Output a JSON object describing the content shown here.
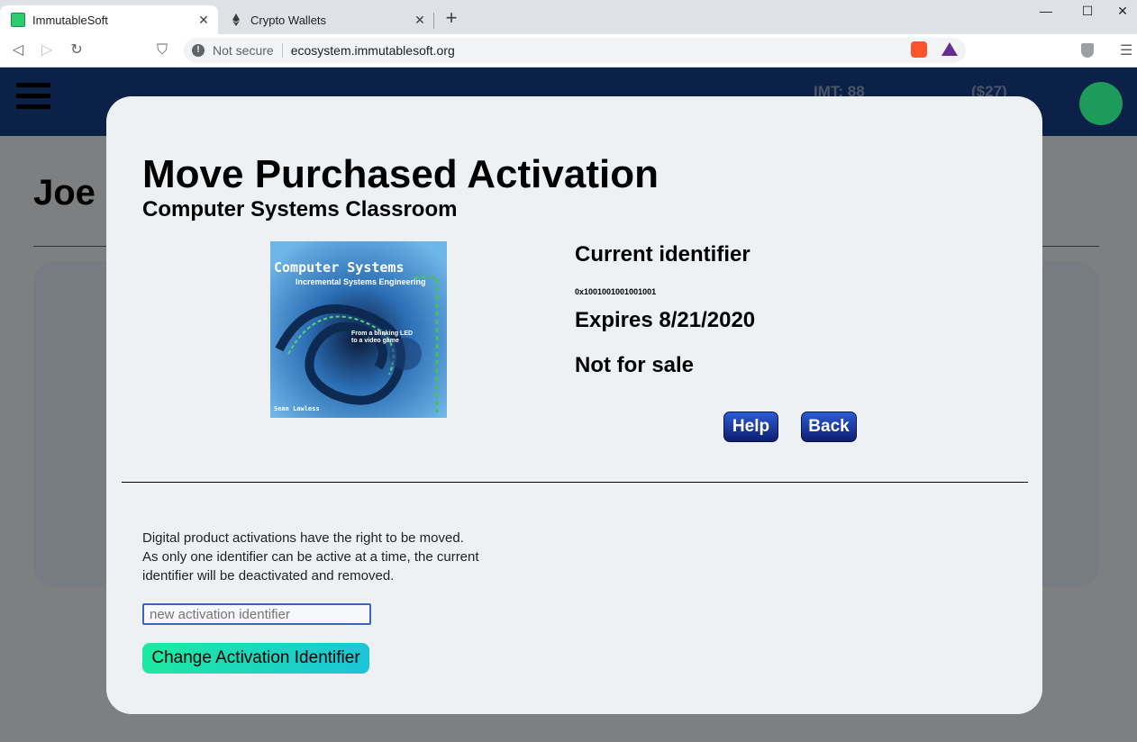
{
  "browser": {
    "tabs": [
      {
        "title": "ImmutableSoft",
        "close": "✕"
      },
      {
        "title": "Crypto Wallets",
        "close": "✕"
      }
    ],
    "new_tab": "+",
    "window_controls": {
      "minimize": "—",
      "maximize": "☐",
      "close": "✕"
    },
    "nav": {
      "back": "◁",
      "forward": "▷",
      "reload": "↻",
      "bookmark": "⛉"
    },
    "security_label": "Not secure",
    "url": "ecosystem.immutablesoft.org",
    "menu": "☰"
  },
  "background_page": {
    "imt_balance": "IMT: 88",
    "usd_balance": "($27)",
    "user_heading": "Joe"
  },
  "modal": {
    "title": "Move Purchased Activation",
    "subtitle": "Computer Systems Classroom",
    "product_image": {
      "title": "Computer Systems",
      "subtitle": "Incremental Systems Engineering",
      "tagline_1": "From a blinking LED",
      "tagline_2": "to a video game",
      "author": "Sean Lawless"
    },
    "current_identifier_label": "Current identifier",
    "current_identifier_value": "0x1001001001001001",
    "expires": "Expires 8/21/2020",
    "sale_status": "Not for sale",
    "help_button": "Help",
    "back_button": "Back",
    "description": [
      "Digital product activations have the right to be moved.",
      "As only one identifier can be active at a time, the current",
      "identifier will be deactivated and removed."
    ],
    "new_identifier_placeholder": "new activation identifier",
    "change_button": "Change Activation Identifier"
  }
}
